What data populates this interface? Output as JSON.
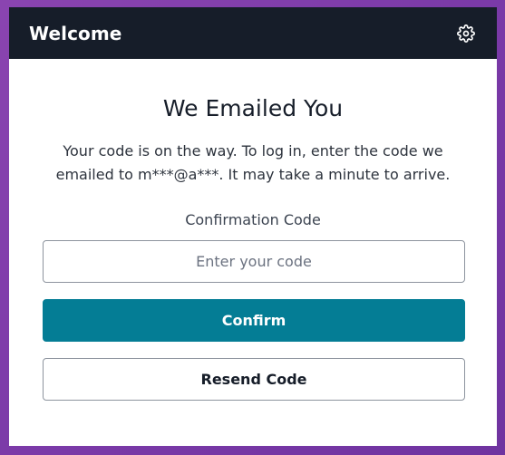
{
  "header": {
    "title": "Welcome",
    "settings_icon": "gear-icon"
  },
  "main": {
    "heading": "We Emailed You",
    "description": "Your code is on the way. To log in, enter the code we emailed to m***@a***. It may take a minute to arrive.",
    "code_label": "Confirmation Code",
    "code_input": {
      "value": "",
      "placeholder": "Enter your code"
    },
    "confirm_label": "Confirm",
    "resend_label": "Resend Code"
  },
  "colors": {
    "header_bg": "#161d29",
    "primary": "#047d95",
    "background": "#7b3aa8"
  }
}
